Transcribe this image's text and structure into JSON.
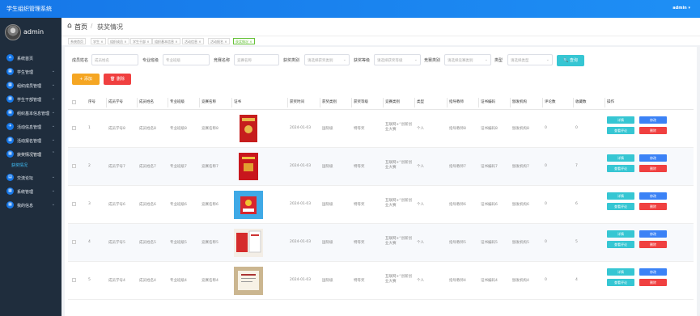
{
  "app": {
    "title": "学生组织管理系统",
    "user": "admin"
  },
  "sidebar": {
    "admin_name": "admin",
    "items": [
      {
        "label": "系统首页",
        "arrow": ""
      },
      {
        "label": "学生管理",
        "arrow": "⌄"
      },
      {
        "label": "组织成员管理",
        "arrow": "⌄"
      },
      {
        "label": "学生干部管理",
        "arrow": "⌄"
      },
      {
        "label": "组织基本信息管理",
        "arrow": "⌄"
      },
      {
        "label": "活动信息管理",
        "arrow": "⌄"
      },
      {
        "label": "活动报名管理",
        "arrow": "⌄"
      },
      {
        "label": "获奖情况管理",
        "arrow": "⌃"
      },
      {
        "label": "交流论坛",
        "arrow": "⌄"
      },
      {
        "label": "系统管理",
        "arrow": "⌄"
      },
      {
        "label": "我的信息",
        "arrow": "⌄"
      }
    ],
    "sub_item": "获奖情况"
  },
  "header": {
    "home": "首页",
    "separator": "/",
    "current": "获奖情况"
  },
  "tabs": [
    "系统首页",
    "学生 ×",
    "组织成员 ×",
    "学生干部 ×",
    "组织基本信息 ×",
    "活动信息 ×",
    "活动报名 ×",
    "获奖情况 ×"
  ],
  "filters": [
    {
      "label": "成员姓名",
      "placeholder": "成员姓名",
      "dropdown": false
    },
    {
      "label": "专业班级",
      "placeholder": "专业班级",
      "dropdown": false
    },
    {
      "label": "竞赛名称",
      "placeholder": "竞赛名称",
      "dropdown": false
    },
    {
      "label": "获奖类别",
      "placeholder": "请选择获奖类别",
      "dropdown": true
    },
    {
      "label": "获奖等级",
      "placeholder": "请选择获奖等级",
      "dropdown": true
    },
    {
      "label": "竞赛类别",
      "placeholder": "请选择竞赛类别",
      "dropdown": true
    },
    {
      "label": "类型",
      "placeholder": "请选择类型",
      "dropdown": true
    }
  ],
  "buttons": {
    "query": "🔍 查询",
    "add": "+ 添加",
    "delete": "🗑 删除"
  },
  "table": {
    "headers": [
      "序号",
      "成员学号",
      "成员姓名",
      "专业班级",
      "竞赛名称",
      "证书",
      "获奖时间",
      "获奖类别",
      "获奖等级",
      "竞赛类别",
      "类型",
      "指导教师",
      "证书编码",
      "颁发机构",
      "评论数",
      "收藏数",
      "操作"
    ],
    "rows": [
      {
        "no": "1",
        "sid": "成员学号8",
        "name": "成员姓名8",
        "cls": "专业班级8",
        "comp": "竞赛名称8",
        "time": "2024-01-03",
        "cat": "国际级",
        "level": "特等奖",
        "ctype": "互联网+“创新创业大赛",
        "type": "个人",
        "teacher": "指导教师8",
        "code": "证书编码8",
        "org": "颁发机构8",
        "comments": "0",
        "favs": "0",
        "thumb": "red-book"
      },
      {
        "no": "2",
        "sid": "成员学号7",
        "name": "成员姓名7",
        "cls": "专业班级7",
        "comp": "竞赛名称7",
        "time": "2024-01-03",
        "cat": "国际级",
        "level": "特等奖",
        "ctype": "互联网+“创新创业大赛",
        "type": "个人",
        "teacher": "指导教师7",
        "code": "证书编码7",
        "org": "颁发机构7",
        "comments": "0",
        "favs": "7",
        "thumb": "red-cert"
      },
      {
        "no": "3",
        "sid": "成员学号6",
        "name": "成员姓名6",
        "cls": "专业班级6",
        "comp": "竞赛名称6",
        "time": "2024-01-03",
        "cat": "国际级",
        "level": "特等奖",
        "ctype": "互联网+“创新创业大赛",
        "type": "个人",
        "teacher": "指导教师6",
        "code": "证书编码6",
        "org": "颁发机构6",
        "comments": "0",
        "favs": "6",
        "thumb": "blue-cert"
      },
      {
        "no": "4",
        "sid": "成员学号5",
        "name": "成员姓名5",
        "cls": "专业班级5",
        "comp": "竞赛名称5",
        "time": "2024-01-03",
        "cat": "国际级",
        "level": "特等奖",
        "ctype": "互联网+“创新创业大赛",
        "type": "个人",
        "teacher": "指导教师5",
        "code": "证书编码5",
        "org": "颁发机构5",
        "comments": "0",
        "favs": "5",
        "thumb": "cert-set"
      },
      {
        "no": "5",
        "sid": "成员学号4",
        "name": "成员姓名4",
        "cls": "专业班级4",
        "comp": "竞赛名称4",
        "time": "2024-01-03",
        "cat": "国际级",
        "level": "特等奖",
        "ctype": "互联网+“创新创业大赛",
        "type": "个人",
        "teacher": "指导教师4",
        "code": "证书编码4",
        "org": "颁发机构4",
        "comments": "0",
        "favs": "4",
        "thumb": "cert-frame"
      }
    ],
    "actions": {
      "detail": "详情",
      "edit": "修改",
      "review": "查看评论",
      "del": "删除"
    }
  },
  "colors": {
    "topbar": "#1677e8",
    "sidebar": "#1f2d3d",
    "query": "#36c6d3",
    "add": "#f5a623",
    "danger": "#f04040",
    "primary": "#3b82f6"
  }
}
